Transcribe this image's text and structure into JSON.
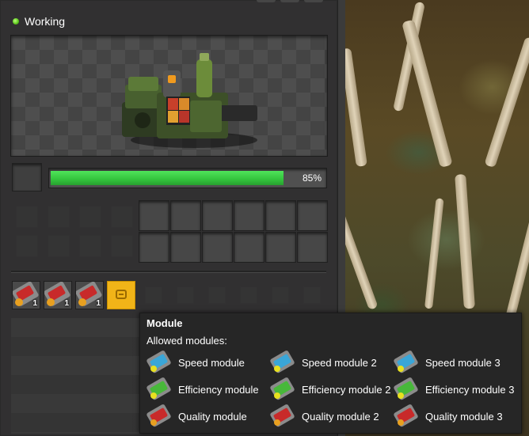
{
  "status": {
    "label": "Working",
    "color": "#5bc41a"
  },
  "progress": {
    "value": 0.85,
    "label": "85%",
    "color": "#33c33c"
  },
  "modules": {
    "inserted": [
      {
        "name": "Quality module",
        "qty": "1"
      },
      {
        "name": "Quality module",
        "qty": "1"
      },
      {
        "name": "Quality module",
        "qty": "1"
      }
    ],
    "hover_slot_color": "#f1b418"
  },
  "tooltip": {
    "title": "Module",
    "subtitle": "Allowed modules:",
    "items": [
      {
        "label": "Speed module",
        "icon": "speed-module-icon",
        "color": "#3aa6d8"
      },
      {
        "label": "Speed module 2",
        "icon": "speed-module-2-icon",
        "color": "#3aa6d8"
      },
      {
        "label": "Speed module 3",
        "icon": "speed-module-3-icon",
        "color": "#3aa6d8"
      },
      {
        "label": "Efficiency module",
        "icon": "efficiency-module-icon",
        "color": "#48b83a"
      },
      {
        "label": "Efficiency module 2",
        "icon": "efficiency-module-2-icon",
        "color": "#48b83a"
      },
      {
        "label": "Efficiency module 3",
        "icon": "efficiency-module-3-icon",
        "color": "#48b83a"
      },
      {
        "label": "Quality module",
        "icon": "quality-module-icon",
        "color": "#c82a2a"
      },
      {
        "label": "Quality module 2",
        "icon": "quality-module-2-icon",
        "color": "#c82a2a"
      },
      {
        "label": "Quality module 3",
        "icon": "quality-module-3-icon",
        "color": "#c82a2a"
      }
    ]
  }
}
